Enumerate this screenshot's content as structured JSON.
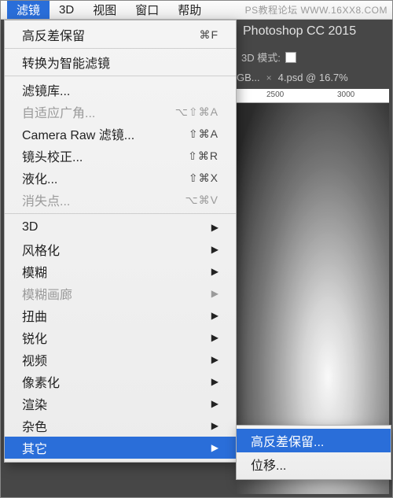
{
  "watermark": "PS教程论坛  WWW.16XX8.COM",
  "menubar": {
    "items": [
      "滤镜",
      "3D",
      "视图",
      "窗口",
      "帮助"
    ],
    "selected": 0
  },
  "app": {
    "title": "Photoshop CC 2015",
    "mode_label": "3D 模式:",
    "tab_gb": "GB...",
    "tab_x": "×",
    "tab_doc": "4.psd @ 16.7%",
    "ruler": {
      "t1": "2500",
      "t2": "3000"
    }
  },
  "menu": {
    "last_filter": {
      "label": "高反差保留",
      "shortcut": "⌘F"
    },
    "convert_smart": "转换为智能滤镜",
    "filter_gallery": "滤镜库...",
    "adaptive_wide": {
      "label": "自适应广角...",
      "shortcut": "⌥⇧⌘A"
    },
    "camera_raw": {
      "label": "Camera Raw 滤镜...",
      "shortcut": "⇧⌘A"
    },
    "lens_correction": {
      "label": "镜头校正...",
      "shortcut": "⇧⌘R"
    },
    "liquify": {
      "label": "液化...",
      "shortcut": "⇧⌘X"
    },
    "vanishing_point": {
      "label": "消失点...",
      "shortcut": "⌥⌘V"
    },
    "sub_3d": "3D",
    "stylize": "风格化",
    "blur": "模糊",
    "blur_gallery": "模糊画廊",
    "distort": "扭曲",
    "sharpen": "锐化",
    "video": "视频",
    "pixelate": "像素化",
    "render": "渲染",
    "noise": "杂色",
    "other": "其它"
  },
  "submenu": {
    "high_pass": "高反差保留...",
    "offset": "位移..."
  }
}
